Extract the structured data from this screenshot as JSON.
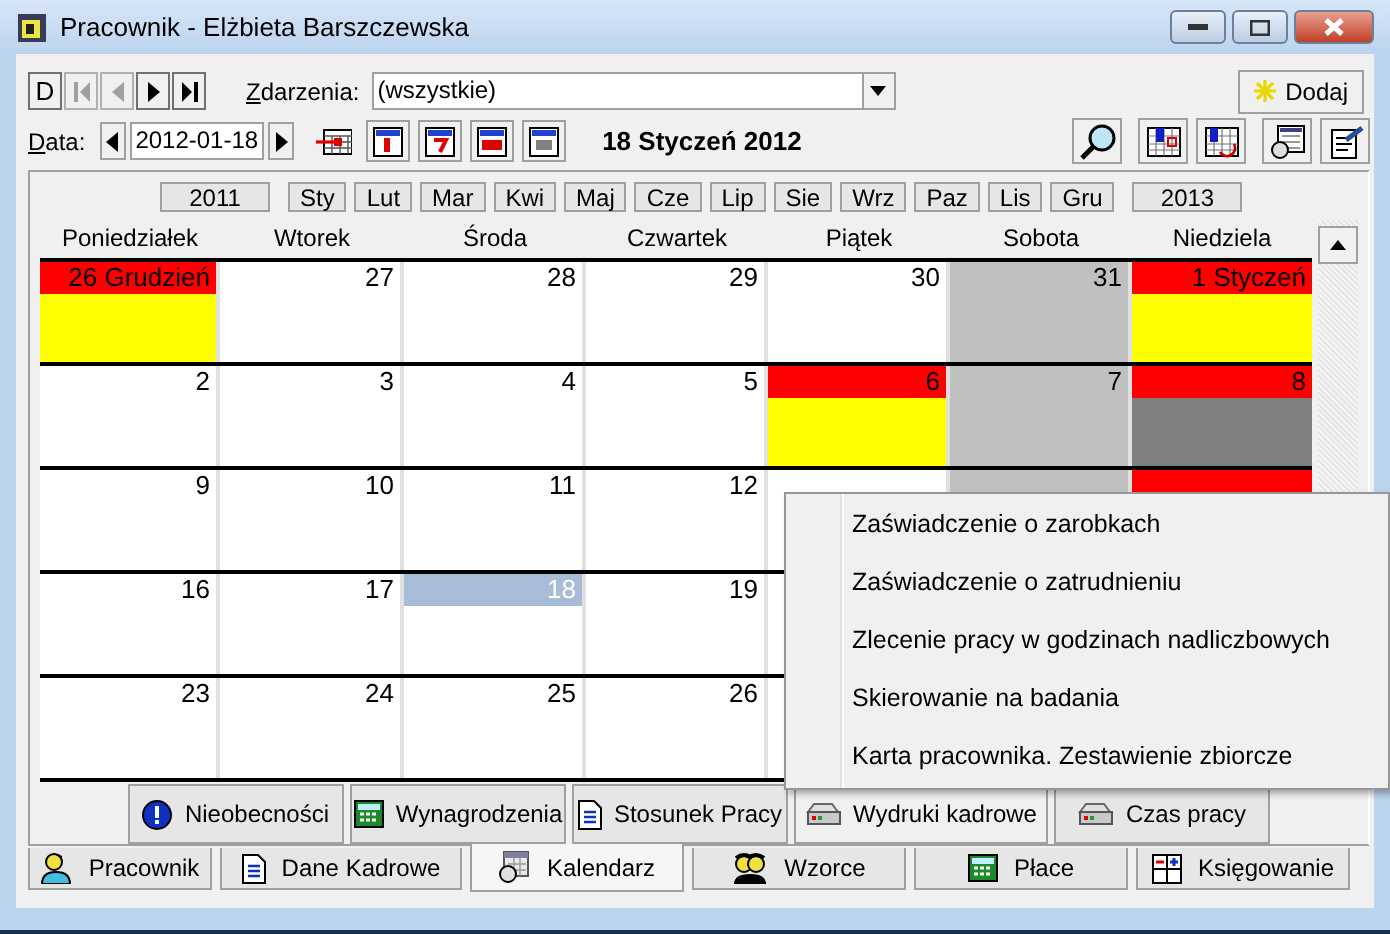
{
  "window": {
    "title": "Pracownik - Elżbieta Barszczewska"
  },
  "toolbar": {
    "nav": [
      {
        "kind": "text",
        "label": "D",
        "disabled": false
      },
      {
        "kind": "first",
        "disabled": true
      },
      {
        "kind": "prev",
        "disabled": true
      },
      {
        "kind": "next",
        "disabled": false
      },
      {
        "kind": "last",
        "disabled": false
      }
    ],
    "events_label": "Zdarzenia:",
    "events_value": "(wszystkie)",
    "add_button": "Dodaj",
    "date_label": "Data:",
    "date_value": "2012-01-18",
    "date_heading": "18 Styczeń 2012"
  },
  "calendar": {
    "prev_year": "2011",
    "next_year": "2013",
    "months": [
      "Sty",
      "Lut",
      "Mar",
      "Kwi",
      "Maj",
      "Cze",
      "Lip",
      "Sie",
      "Wrz",
      "Paz",
      "Lis",
      "Gru"
    ],
    "weekdays": [
      "Poniedziałek",
      "Wtorek",
      "Środa",
      "Czwartek",
      "Piątek",
      "Sobota",
      "Niedziela"
    ],
    "weeks": [
      [
        {
          "day": "26 Grudzień",
          "selected": false,
          "kind": "absence"
        },
        {
          "day": "27",
          "selected": false,
          "kind": "workday"
        },
        {
          "day": "28",
          "selected": false,
          "kind": "workday"
        },
        {
          "day": "29",
          "selected": false,
          "kind": "workday"
        },
        {
          "day": "30",
          "selected": false,
          "kind": "workday"
        },
        {
          "day": "31",
          "selected": false,
          "kind": "weekend"
        },
        {
          "day": "1 Styczeń",
          "selected": false,
          "kind": "absence"
        }
      ],
      [
        {
          "day": "2",
          "selected": false,
          "kind": "workday"
        },
        {
          "day": "3",
          "selected": false,
          "kind": "workday"
        },
        {
          "day": "4",
          "selected": false,
          "kind": "workday"
        },
        {
          "day": "5",
          "selected": false,
          "kind": "workday"
        },
        {
          "day": "6",
          "selected": false,
          "kind": "absence"
        },
        {
          "day": "7",
          "selected": false,
          "kind": "weekend"
        },
        {
          "day": "8",
          "selected": false,
          "kind": "holiday"
        }
      ],
      [
        {
          "day": "9",
          "selected": false,
          "kind": "workday"
        },
        {
          "day": "10",
          "selected": false,
          "kind": "workday"
        },
        {
          "day": "11",
          "selected": false,
          "kind": "workday"
        },
        {
          "day": "12",
          "selected": false,
          "kind": "workday"
        },
        {
          "selected": false,
          "kind": "workday"
        },
        {
          "selected": false,
          "kind": "weekend"
        },
        {
          "selected": false,
          "kind": "absence"
        }
      ],
      [
        {
          "day": "16",
          "selected": false,
          "kind": "workday"
        },
        {
          "day": "17",
          "selected": false,
          "kind": "workday"
        },
        {
          "day": "18",
          "selected": true,
          "kind": "workday"
        },
        {
          "day": "19",
          "selected": false,
          "kind": "workday"
        }
      ],
      [
        {
          "day": "23",
          "selected": false,
          "kind": "workday"
        },
        {
          "day": "24",
          "selected": false,
          "kind": "workday"
        },
        {
          "day": "25",
          "selected": false,
          "kind": "workday"
        },
        {
          "day": "26",
          "selected": false,
          "kind": "workday"
        }
      ]
    ]
  },
  "bottom_buttons": [
    {
      "label": "Nieobecności",
      "kind": "alert"
    },
    {
      "label": "Wynagrodzenia",
      "kind": "calculator"
    },
    {
      "label": "Stosunek Pracy",
      "kind": "document"
    },
    {
      "label": "Wydruki kadrowe",
      "kind": "printer"
    },
    {
      "label": "Czas pracy",
      "kind": "printer"
    }
  ],
  "tabs": [
    {
      "label": "Pracownik",
      "kind": "person",
      "selected": false
    },
    {
      "label": "Dane Kadrowe",
      "kind": "document",
      "selected": false
    },
    {
      "label": "Kalendarz",
      "kind": "calendar",
      "selected": true
    },
    {
      "label": "Wzorce",
      "kind": "people",
      "selected": false
    },
    {
      "label": "Płace",
      "kind": "calculator",
      "selected": false
    },
    {
      "label": "Księgowanie",
      "kind": "ledger",
      "selected": false
    }
  ],
  "context_menu": {
    "items": [
      "Zaświadczenie o zarobkach",
      "Zaświadczenie o zatrudnieniu",
      "Zlecenie pracy w godzinach nadliczbowych",
      "Skierowanie na badania",
      "Karta pracownika. Zestawienie zbiorcze"
    ]
  }
}
